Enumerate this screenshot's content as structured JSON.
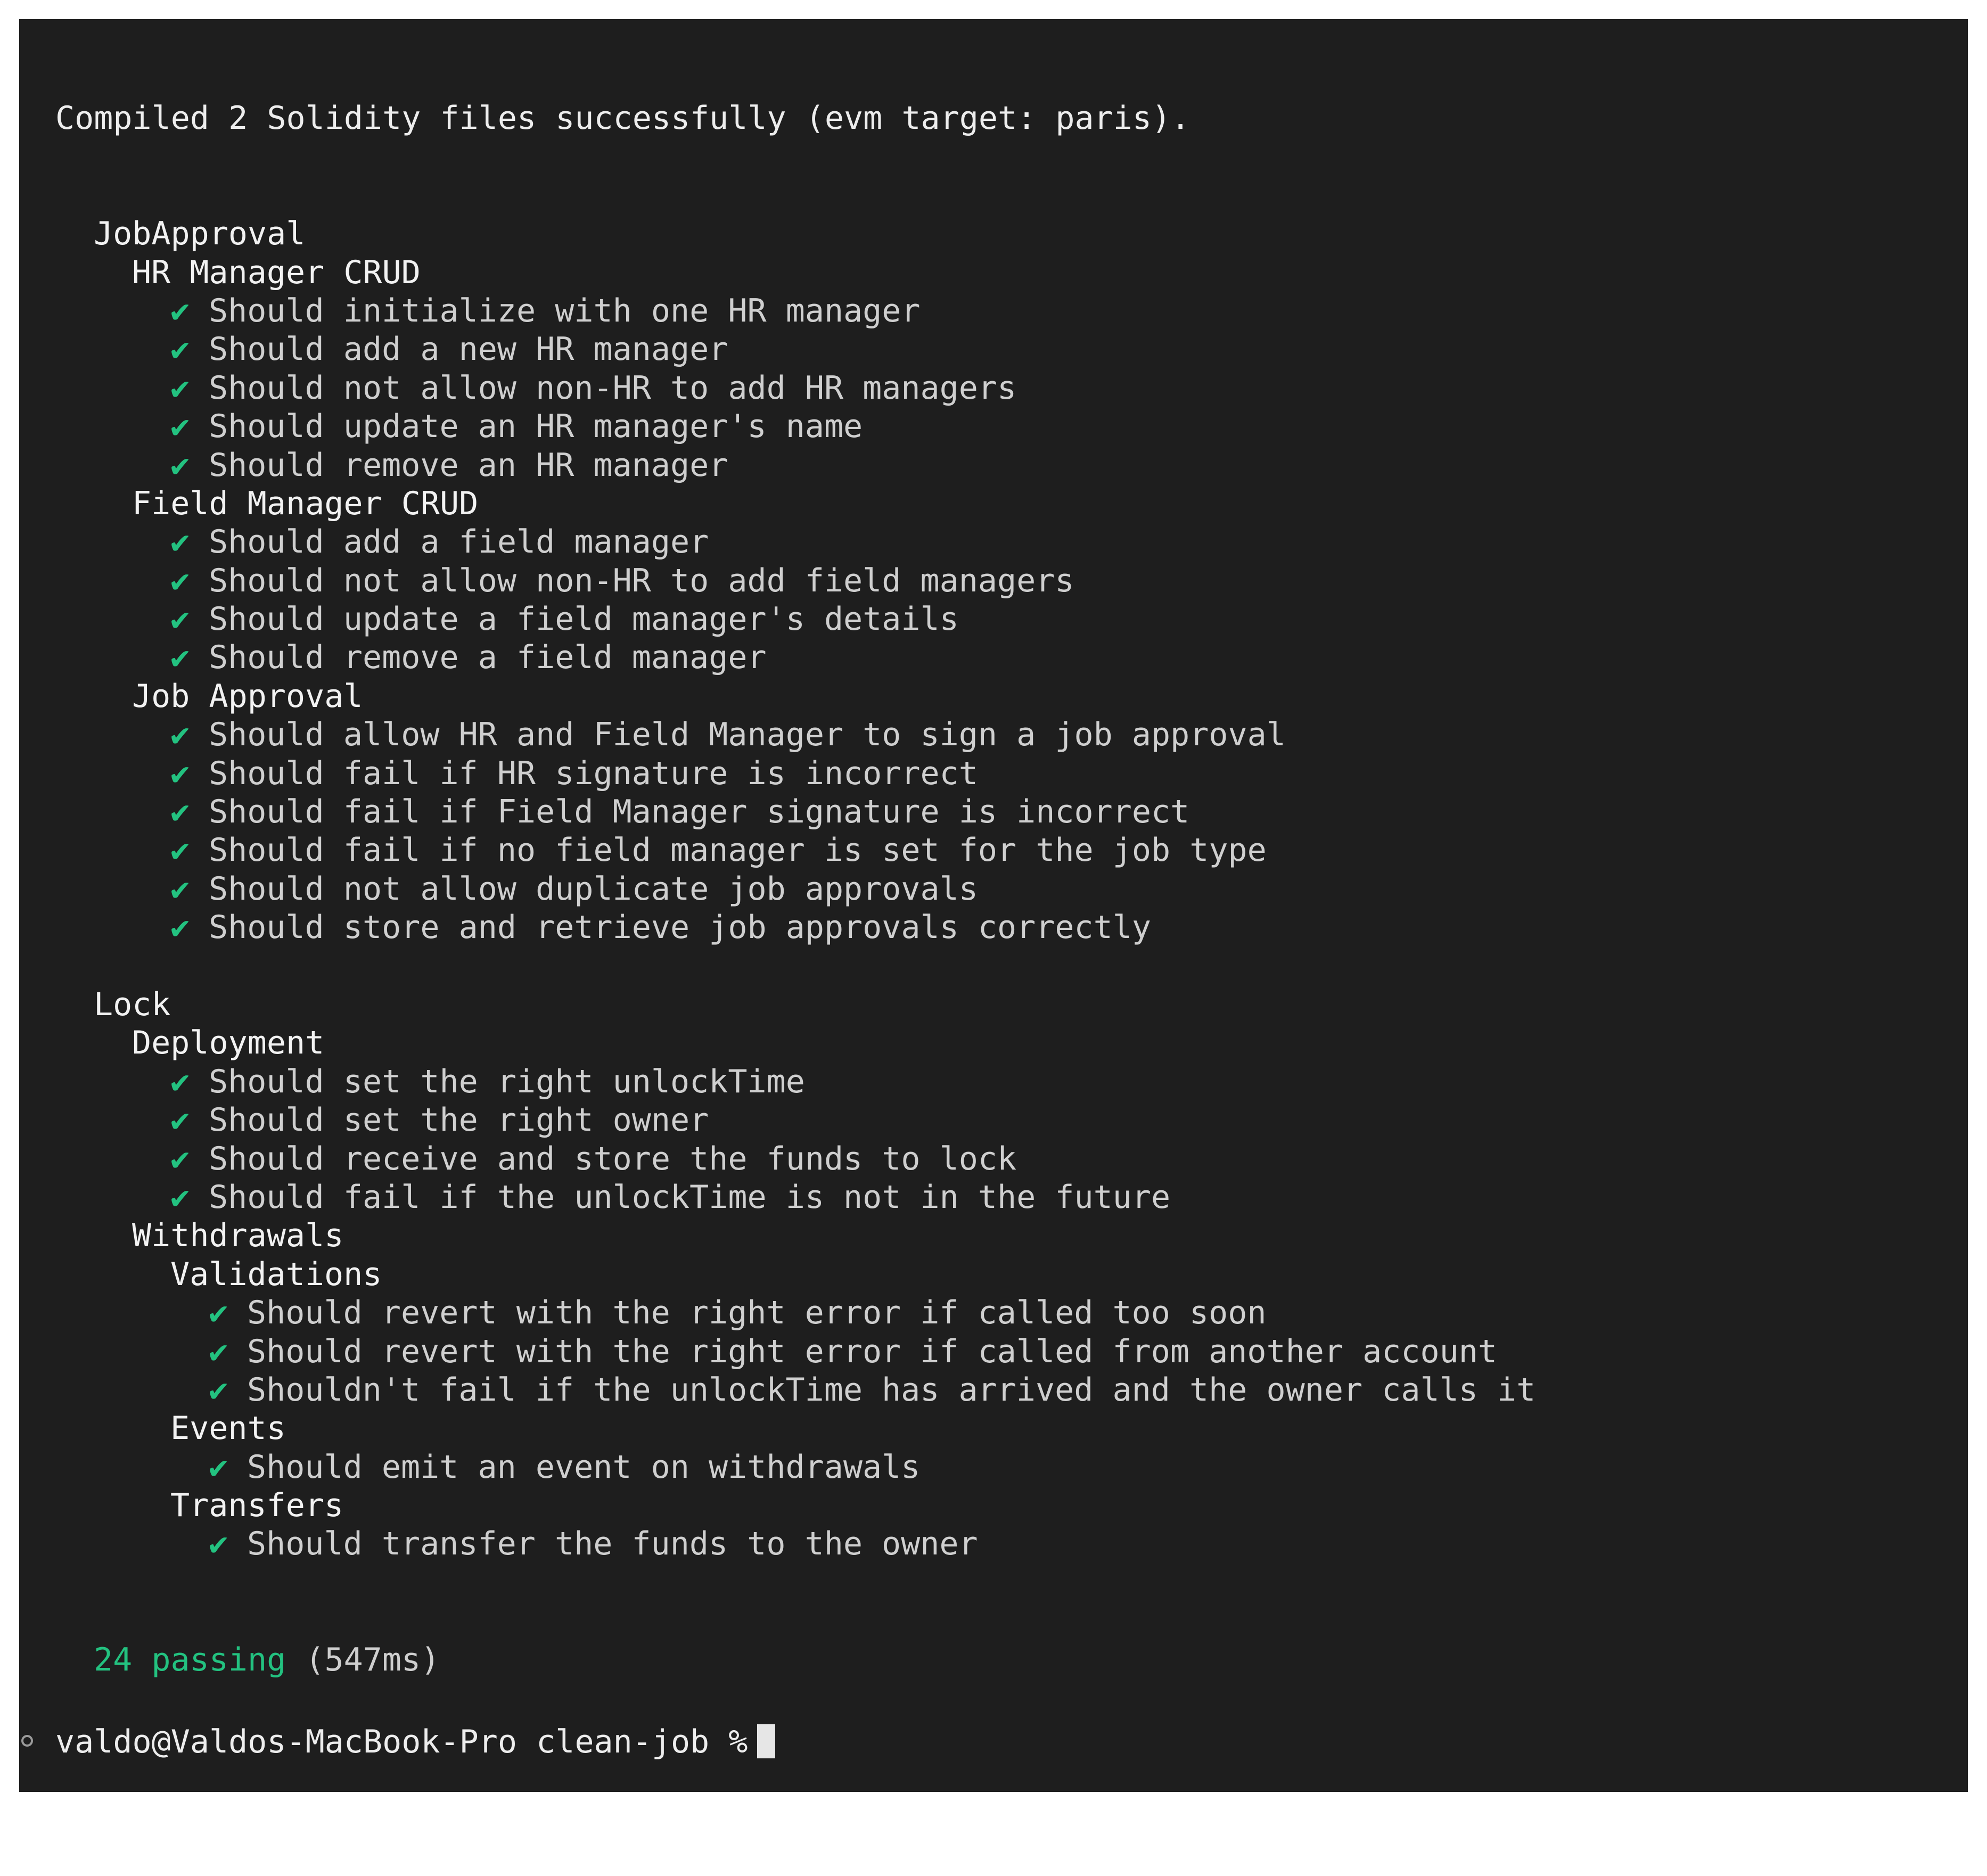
{
  "terminal": {
    "compile_message": "Compiled 2 Solidity files successfully (evm target: paris).",
    "colors": {
      "background": "#1e1e1e",
      "text": "#ededed",
      "check": "#23c280",
      "passing": "#23c280"
    },
    "check_icon": "checkmark-icon",
    "suites": [
      {
        "name": "JobApproval",
        "groups": [
          {
            "name": "HR Manager CRUD",
            "tests": [
              "Should initialize with one HR manager",
              "Should add a new HR manager",
              "Should not allow non-HR to add HR managers",
              "Should update an HR manager's name",
              "Should remove an HR manager"
            ]
          },
          {
            "name": "Field Manager CRUD",
            "tests": [
              "Should add a field manager",
              "Should not allow non-HR to add field managers",
              "Should update a field manager's details",
              "Should remove a field manager"
            ]
          },
          {
            "name": "Job Approval",
            "tests": [
              "Should allow HR and Field Manager to sign a job approval",
              "Should fail if HR signature is incorrect",
              "Should fail if Field Manager signature is incorrect",
              "Should fail if no field manager is set for the job type",
              "Should not allow duplicate job approvals",
              "Should store and retrieve job approvals correctly"
            ]
          }
        ]
      },
      {
        "name": "Lock",
        "groups": [
          {
            "name": "Deployment",
            "tests": [
              "Should set the right unlockTime",
              "Should set the right owner",
              "Should receive and store the funds to lock",
              "Should fail if the unlockTime is not in the future"
            ]
          },
          {
            "name": "Withdrawals",
            "subgroups": [
              {
                "name": "Validations",
                "tests": [
                  "Should revert with the right error if called too soon",
                  "Should revert with the right error if called from another account",
                  "Shouldn't fail if the unlockTime has arrived and the owner calls it"
                ]
              },
              {
                "name": "Events",
                "tests": [
                  "Should emit an event on withdrawals"
                ]
              },
              {
                "name": "Transfers",
                "tests": [
                  "Should transfer the funds to the owner"
                ]
              }
            ]
          }
        ]
      }
    ],
    "summary": {
      "passing": "24 passing",
      "duration": "(547ms)"
    },
    "prompt": {
      "text": "valdo@Valdos-MacBook-Pro clean-job %"
    }
  }
}
